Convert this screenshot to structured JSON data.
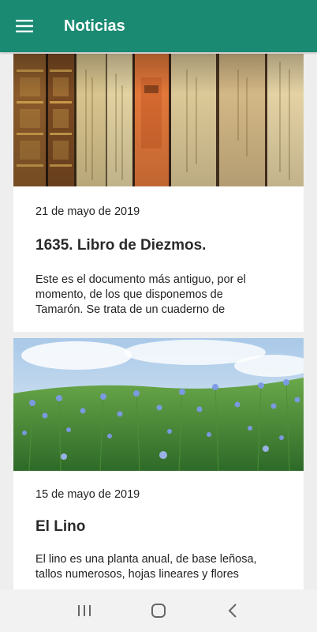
{
  "app_bar": {
    "title": "Noticias",
    "menu_icon": "hamburger-menu-icon",
    "background": "#1a8a72"
  },
  "news": [
    {
      "date": "21 de mayo de 2019",
      "title": "1635. Libro de Diezmos.",
      "excerpt": "Este es el documento más antiguo, por el momento, de los que disponemos de Tamarón. Se trata de un cuaderno de",
      "image": "old-books-photo"
    },
    {
      "date": "15 de mayo de 2019",
      "title": "El Lino",
      "excerpt": "El lino es una planta anual, de base leñosa, tallos numerosos, hojas lineares y flores",
      "image": "flax-flowers-field-photo"
    }
  ],
  "system_nav": {
    "recents_icon": "recent-apps-icon",
    "home_icon": "home-icon",
    "back_icon": "back-icon"
  }
}
